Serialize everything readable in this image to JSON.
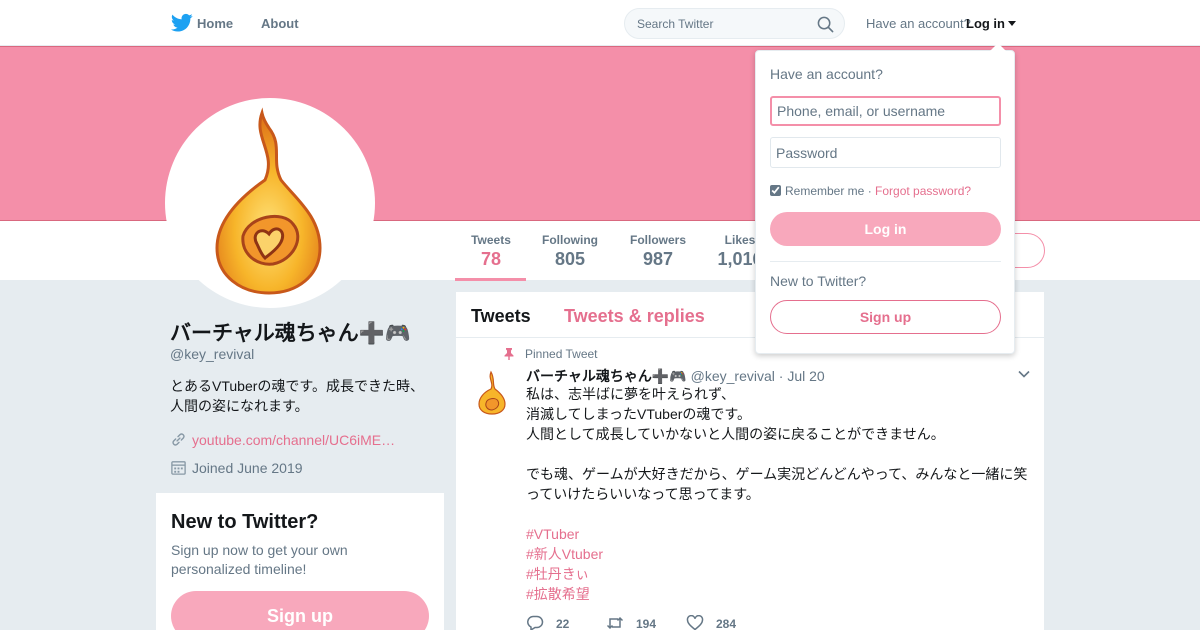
{
  "nav": {
    "home_label": "Home",
    "about_label": "About",
    "search_placeholder": "Search Twitter",
    "have_account": "Have an account?",
    "login_label": "Log in"
  },
  "colors": {
    "accent": "#e56f8e",
    "banner": "#f48fa9",
    "button_fill": "#f8a8bc"
  },
  "stats": [
    {
      "label": "Tweets",
      "value": "78"
    },
    {
      "label": "Following",
      "value": "805"
    },
    {
      "label": "Followers",
      "value": "987"
    },
    {
      "label": "Likes",
      "value": "1,016"
    }
  ],
  "profile": {
    "name": "バーチャル魂ちゃん➕🎮",
    "handle": "@key_revival",
    "bio_lines": [
      "とあるVTuberの魂です。成長できた時、",
      "人間の姿になれます。"
    ],
    "link": "youtube.com/channel/UC6iME…",
    "joined": "Joined June 2019"
  },
  "signup_card": {
    "title": "New to Twitter?",
    "description": "Sign up now to get your own personalized timeline!",
    "button": "Sign up"
  },
  "timeline": {
    "tab_tweets": "Tweets",
    "tab_replies": "Tweets & replies"
  },
  "tweet": {
    "pinned_label": "Pinned Tweet",
    "name": "バーチャル魂ちゃん➕🎮",
    "handle": "@key_revival",
    "date": "· Jul 20",
    "lines": [
      "私は、志半ばに夢を叶えられず、",
      "消滅してしまったVTuberの魂です。",
      "人間として成長していかないと人間の姿に戻ることができません。",
      "",
      "でも魂、ゲームが大好きだから、ゲーム実況どんどんやって、みんなと一緒に笑",
      "っていけたらいいなって思ってます。",
      ""
    ],
    "hashtags": [
      "#VTuber",
      "#新人Vtuber",
      "#牡丹きぃ",
      "#拡散希望"
    ],
    "replies": "22",
    "retweets": "194",
    "likes": "284"
  },
  "login_dropdown": {
    "title": "Have an account?",
    "username_placeholder": "Phone, email, or username",
    "password_placeholder": "Password",
    "remember_label": "Remember me",
    "separator": " · ",
    "forgot_label": "Forgot password?",
    "login_button": "Log in",
    "new_label": "New to Twitter?",
    "signup_button": "Sign up"
  }
}
